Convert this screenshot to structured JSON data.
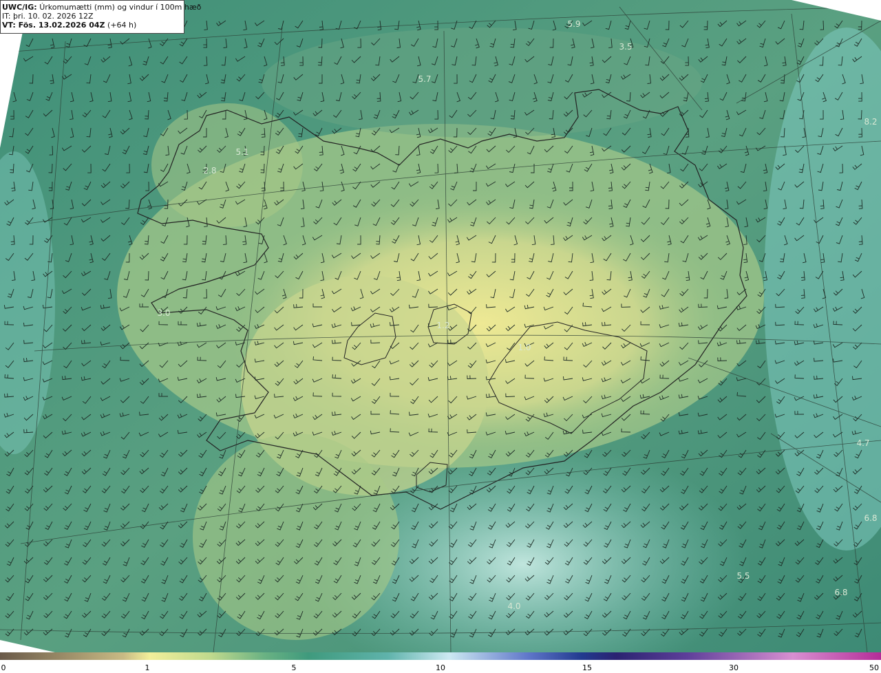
{
  "header": {
    "model_tag": "UWC/IG:",
    "product": "Úrkomumætti (mm) og vindur í 100m hæð",
    "init_time": "IT: þri. 10. 02. 2026 12Z",
    "valid_label": "VT: Fös. 13.02.2026 04Z",
    "lead": "(+64 h)"
  },
  "value_labels": [
    "5.9",
    "3.5",
    "5.7",
    "5.1",
    "2.8",
    "3.0",
    "1.2",
    "1.0",
    "8.2",
    "4.7",
    "6.8",
    "5.5",
    "6.8",
    "4.0"
  ],
  "colorbar": {
    "ticks": [
      "0",
      "1",
      "5",
      "10",
      "15",
      "30",
      "50"
    ],
    "colors": [
      "#6a5a49",
      "#c8ba84",
      "#f2ef9a",
      "#bfd98d",
      "#6ab283",
      "#3f9a7d",
      "#5fb3ab",
      "#cde9f2",
      "#5f76c9",
      "#223a8f",
      "#2b2371",
      "#5e3f9a",
      "#d88fd1",
      "#b42c98"
    ]
  },
  "map": {
    "field_colors": {
      "low": "#eee994",
      "mid": "#8fbf86",
      "high": "#3f8f78",
      "sea": "#7ec9bf",
      "ice": "#cdeee8"
    },
    "coastline_color": "#222222",
    "grid_color": "#2c3e35",
    "barb_color": "#1c2a24"
  }
}
